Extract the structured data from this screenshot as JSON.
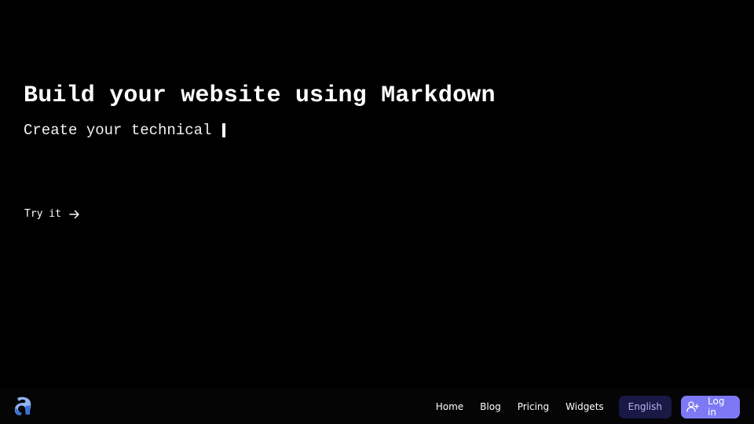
{
  "hero": {
    "title": "Build your website using Markdown",
    "subtitle": "Create your technical"
  },
  "cta": {
    "label": "Try it",
    "icon": "arrow-right-icon"
  },
  "navbar": {
    "logo_icon": "brand-logo-icon",
    "links": [
      "Home",
      "Blog",
      "Pricing",
      "Widgets"
    ],
    "language_label": "English",
    "login_label": "Log in",
    "login_icon": "user-plus-icon"
  },
  "colors": {
    "background": "#000000",
    "navbar_background": "#050505",
    "language_button_bg": "#1a1845",
    "language_button_text": "#b9b6f2",
    "login_button_bg": "#7d79f5",
    "logo_light": "#8fb4f2",
    "logo_dark": "#3a6fd8"
  }
}
